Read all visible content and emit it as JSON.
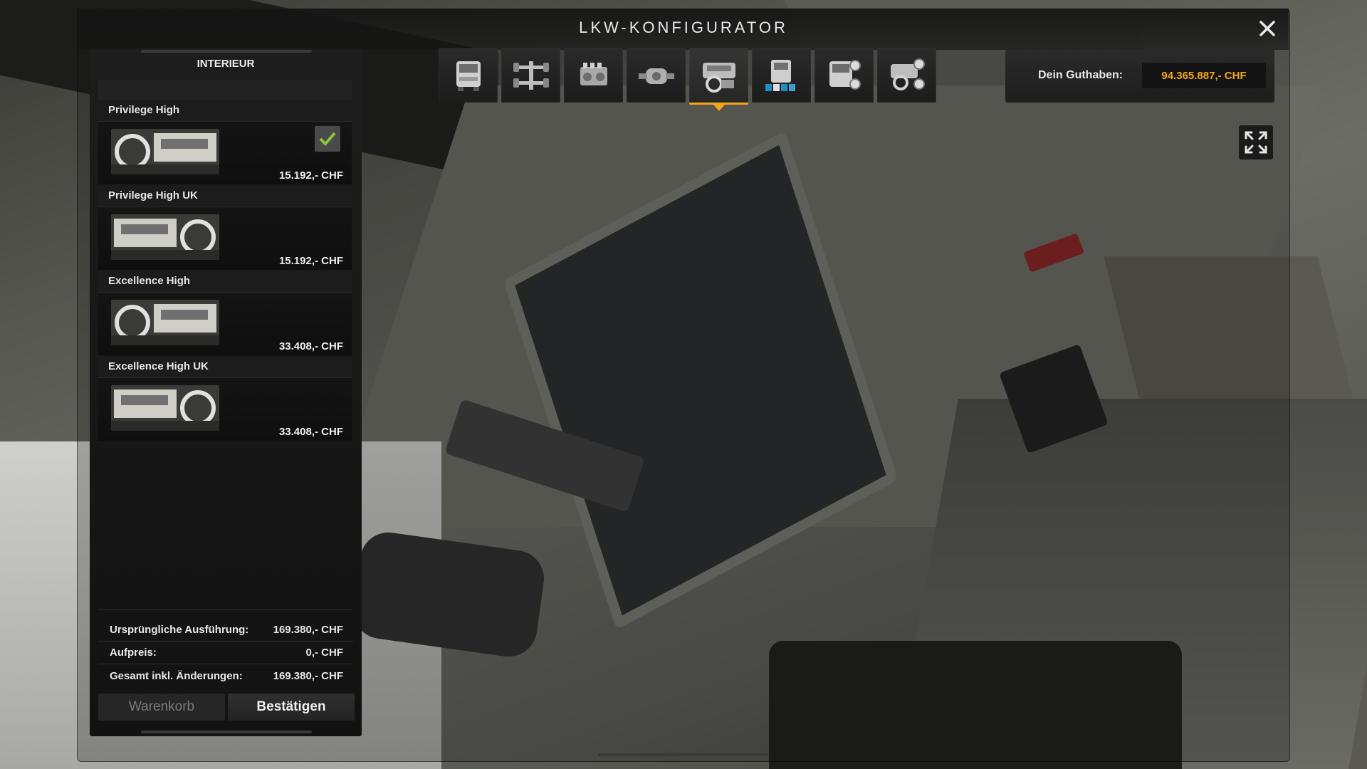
{
  "window": {
    "title": "LKW-KONFIGURATOR",
    "close_icon": "close-icon"
  },
  "tabs": [
    {
      "name": "chassis",
      "icon": "truck-icon",
      "active": false
    },
    {
      "name": "axle",
      "icon": "axle-icon",
      "active": false
    },
    {
      "name": "engine",
      "icon": "engine-icon",
      "active": false
    },
    {
      "name": "transmission",
      "icon": "transmission-icon",
      "active": false
    },
    {
      "name": "interior",
      "icon": "interior-icon",
      "active": true
    },
    {
      "name": "paint",
      "icon": "paint-icon",
      "active": false
    },
    {
      "name": "exterior-accessories",
      "icon": "exterior-parts-icon",
      "active": false
    },
    {
      "name": "interior-accessories",
      "icon": "interior-parts-icon",
      "active": false
    }
  ],
  "balance": {
    "label": "Dein Guthaben:",
    "value": "94.365.887,- CHF"
  },
  "panel": {
    "heading": "INTERIEUR",
    "items": [
      {
        "name": "Privilege High",
        "price": "15.192,- CHF",
        "selected": true,
        "thumb_variant": "left"
      },
      {
        "name": "Privilege High UK",
        "price": "15.192,- CHF",
        "selected": false,
        "thumb_variant": "right"
      },
      {
        "name": "Excellence High",
        "price": "33.408,- CHF",
        "selected": false,
        "thumb_variant": "left"
      },
      {
        "name": "Excellence High UK",
        "price": "33.408,- CHF",
        "selected": false,
        "thumb_variant": "right"
      }
    ]
  },
  "summary": {
    "original_label": "Ursprüngliche Ausführung:",
    "original_value": "169.380,- CHF",
    "surcharge_label": "Aufpreis:",
    "surcharge_value": "0,- CHF",
    "total_label": "Gesamt inkl. Änderungen:",
    "total_value": "169.380,- CHF"
  },
  "buttons": {
    "cart": "Warenkorb",
    "confirm": "Bestätigen"
  },
  "colors": {
    "accent": "#f2a51a",
    "check": "#8cc63f",
    "balance": "#f4a71b"
  }
}
